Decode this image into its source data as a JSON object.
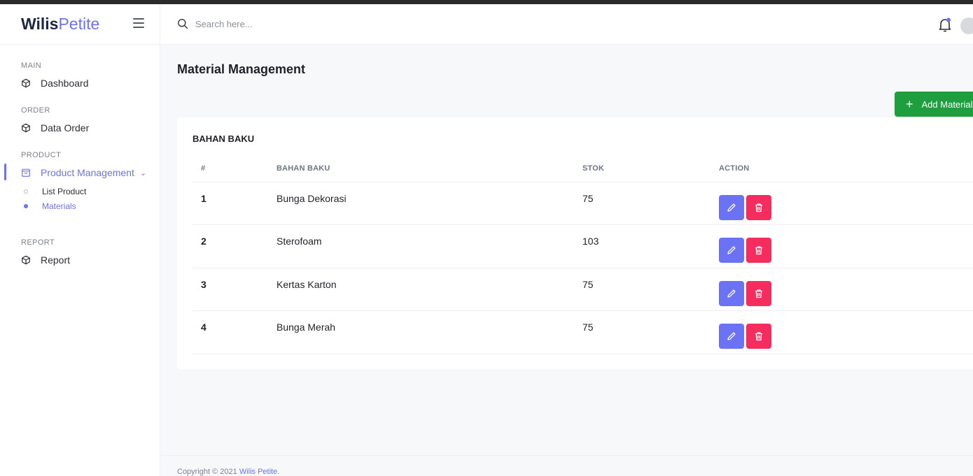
{
  "brand": {
    "bold": "Wilis",
    "light": "Petite"
  },
  "search": {
    "placeholder": "Search here..."
  },
  "sidebar": {
    "sections": [
      {
        "title": "MAIN",
        "items": [
          {
            "label": "Dashboard",
            "icon": "cube-icon"
          }
        ]
      },
      {
        "title": "ORDER",
        "items": [
          {
            "label": "Data Order",
            "icon": "cube-icon"
          }
        ]
      },
      {
        "title": "PRODUCT",
        "items": [
          {
            "label": "Product Management",
            "icon": "shopping-bag-icon",
            "sub": [
              "List Product",
              "Materials"
            ]
          }
        ]
      },
      {
        "title": "REPORT",
        "items": [
          {
            "label": "Report",
            "icon": "cube-icon"
          }
        ]
      }
    ]
  },
  "page": {
    "title": "Material Management",
    "add_button": "Add Material"
  },
  "table": {
    "title": "BAHAN BAKU",
    "columns": [
      "#",
      "BAHAN BAKU",
      "STOK",
      "ACTION"
    ],
    "rows": [
      {
        "no": "1",
        "name": "Bunga Dekorasi",
        "stock": "75"
      },
      {
        "no": "2",
        "name": "Sterofoam",
        "stock": "103"
      },
      {
        "no": "3",
        "name": "Kertas Karton",
        "stock": "75"
      },
      {
        "no": "4",
        "name": "Bunga Merah",
        "stock": "75"
      }
    ]
  },
  "footer": {
    "prefix": "Copyright © 2021 ",
    "brand": "Wilis Petite."
  },
  "colors": {
    "accent": "#6c72f4",
    "success": "#1e9e3e",
    "danger": "#f52d5f"
  }
}
